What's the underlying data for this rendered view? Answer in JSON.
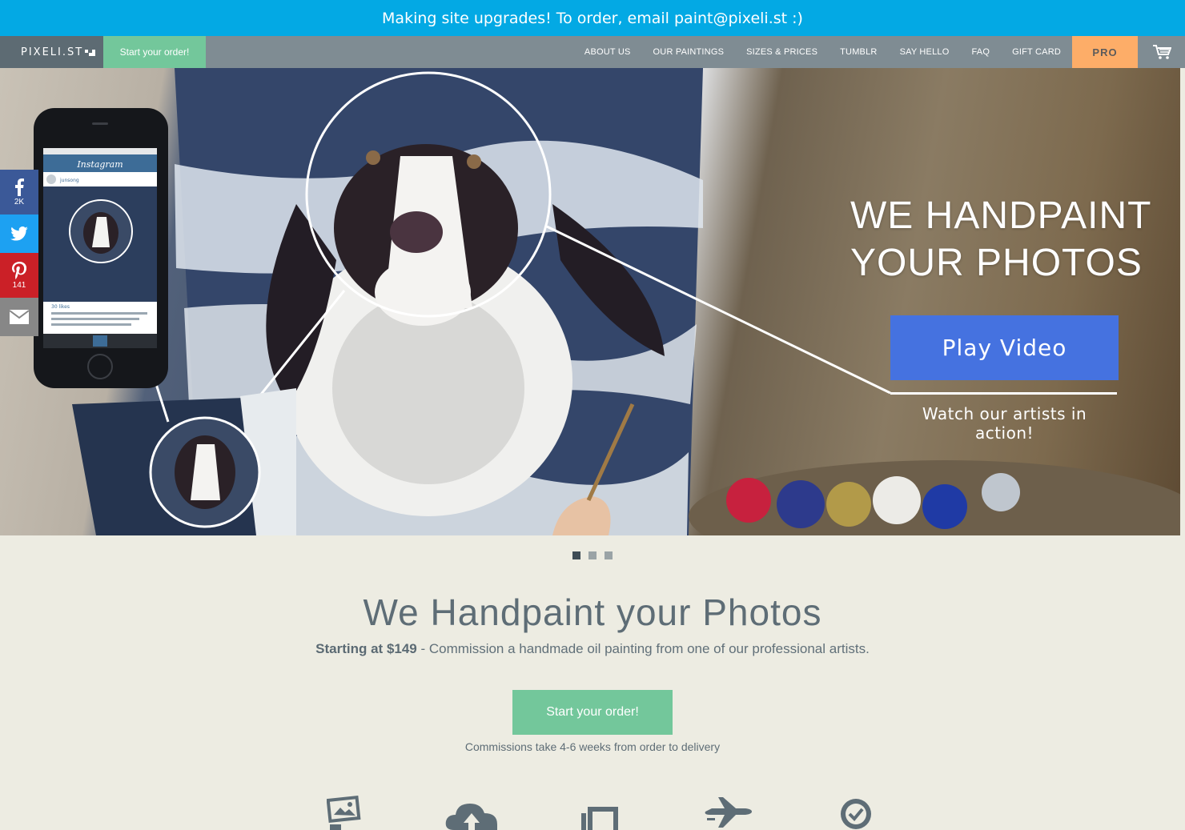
{
  "announcement": "Making site upgrades! To order, email paint@pixeli.st :)",
  "nav": {
    "logo": "PIXELI.ST",
    "cta": "Start your order!",
    "links": [
      "ABOUT US",
      "OUR PAINTINGS",
      "SIZES & PRICES",
      "TUMBLR",
      "SAY HELLO",
      "FAQ",
      "GIFT CARD"
    ],
    "pro": "PRO",
    "cart_icon": "cart-icon"
  },
  "hero": {
    "title_line1": "WE HANDPAINT",
    "title_line2": "YOUR PHOTOS",
    "play_label": "Play Video",
    "watch_text": "Watch our artists in action!",
    "phone_app_title": "Instagram",
    "phone_user": "junsong",
    "phone_likes": "30 likes"
  },
  "share": {
    "facebook_count": "2K",
    "pinterest_count": "141"
  },
  "slider": {
    "count": 3,
    "active": 0
  },
  "main": {
    "title": "We Handpaint your Photos",
    "price_lead": "Starting at $149",
    "price_rest": " - Commission a handmade oil painting from one of our professional artists.",
    "cta": "Start your order!",
    "note": "Commissions take 4-6 weeks from order to delivery"
  },
  "features": [
    "picture-icon",
    "cloud-upload-icon",
    "canvas-icon",
    "airplane-icon",
    "badge-check-icon"
  ],
  "colors": {
    "announce": "#03a9e4",
    "nav": "#7f8c93",
    "cta_green": "#73c79b",
    "pro_orange": "#fdad68",
    "play_blue": "#4572e0",
    "page_bg": "#edece2"
  }
}
